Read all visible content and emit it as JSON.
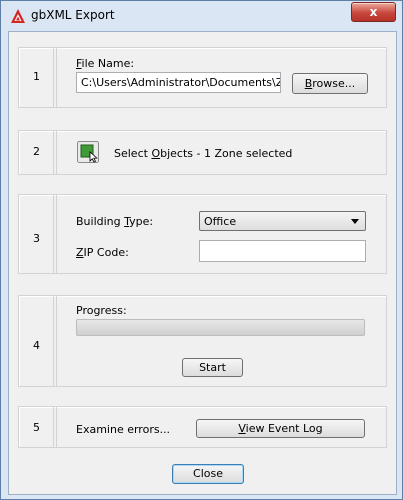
{
  "window": {
    "title": "gbXML Export",
    "close_symbol": "x"
  },
  "step1": {
    "number": "1",
    "file_name_label_key": "F",
    "file_name_label_rest": "ile Name:",
    "file_path": "C:\\Users\\Administrator\\Documents\\Zone",
    "browse_key": "B",
    "browse_rest": "rowse..."
  },
  "step2": {
    "number": "2",
    "select_prefix": "Select ",
    "select_key": "O",
    "select_rest": "bjects - 1 Zone selected"
  },
  "step3": {
    "number": "3",
    "building_type_pre": "Building ",
    "building_type_key": "T",
    "building_type_rest": "ype:",
    "building_type_value": "Office",
    "zip_key": "Z",
    "zip_rest": "IP Code:",
    "zip_value": ""
  },
  "step4": {
    "number": "4",
    "progress_label": "Progress:",
    "progress_value": 0,
    "start_label": "Start"
  },
  "step5": {
    "number": "5",
    "examine_label": "Examine errors...",
    "view_log_key": "V",
    "view_log_rest": "iew Event Log"
  },
  "footer": {
    "close_label": "Close"
  }
}
